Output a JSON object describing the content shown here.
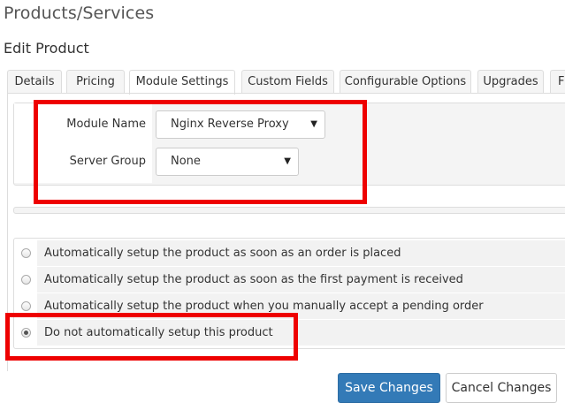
{
  "page": {
    "title": "Products/Services",
    "section": "Edit Product"
  },
  "tabs": [
    {
      "label": "Details"
    },
    {
      "label": "Pricing"
    },
    {
      "label": "Module Settings",
      "active": true
    },
    {
      "label": "Custom Fields"
    },
    {
      "label": "Configurable Options"
    },
    {
      "label": "Upgrades"
    },
    {
      "label": "F"
    }
  ],
  "module": {
    "name_label": "Module Name",
    "name_value": "Nginx Reverse Proxy",
    "group_label": "Server Group",
    "group_value": "None"
  },
  "setup_options": [
    {
      "label": "Automatically setup the product as soon as an order is placed",
      "checked": false
    },
    {
      "label": "Automatically setup the product as soon as the first payment is received",
      "checked": false
    },
    {
      "label": "Automatically setup the product when you manually accept a pending order",
      "checked": false
    },
    {
      "label": "Do not automatically setup this product",
      "checked": true
    }
  ],
  "buttons": {
    "save": "Save Changes",
    "cancel": "Cancel Changes"
  },
  "colors": {
    "highlight": "#ee0000",
    "primary": "#337ab7"
  }
}
